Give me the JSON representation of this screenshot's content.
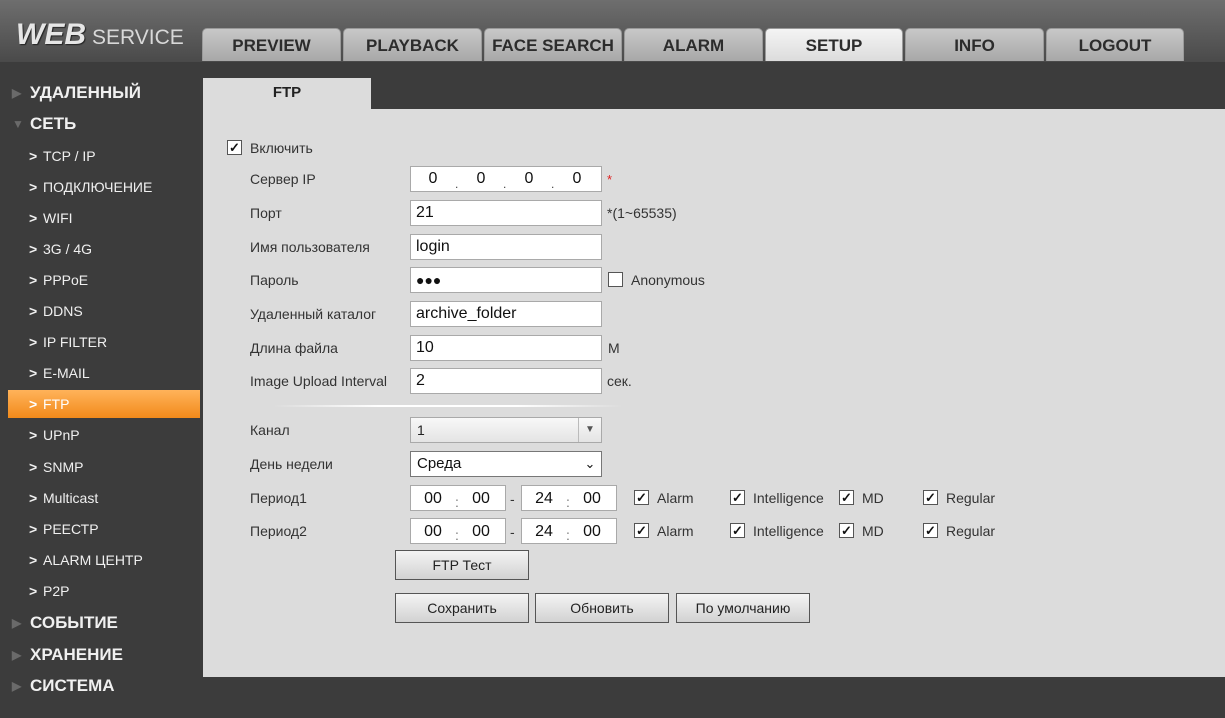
{
  "logo": {
    "word1": "WEB",
    "word2": "SERVICE"
  },
  "tabs": [
    {
      "label": "PREVIEW"
    },
    {
      "label": "PLAYBACK"
    },
    {
      "label": "FACE SEARCH"
    },
    {
      "label": "ALARM"
    },
    {
      "label": "SETUP"
    },
    {
      "label": "INFO"
    },
    {
      "label": "LOGOUT"
    }
  ],
  "active_tab": "SETUP",
  "sidebar": {
    "sections": [
      {
        "label": "УДАЛЕННЫЙ",
        "icon": "triangle-right-icon"
      },
      {
        "label": "СЕТЬ",
        "icon": "triangle-down-icon"
      },
      {
        "label": "СОБЫТИЕ",
        "icon": "triangle-right-icon"
      },
      {
        "label": "ХРАНЕНИЕ",
        "icon": "triangle-right-icon"
      },
      {
        "label": "СИСТЕМА",
        "icon": "triangle-right-icon"
      }
    ],
    "network_items": [
      {
        "label": "TCP / IP"
      },
      {
        "label": "ПОДКЛЮЧЕНИЕ"
      },
      {
        "label": "WIFI"
      },
      {
        "label": "3G / 4G"
      },
      {
        "label": "PPPoE"
      },
      {
        "label": "DDNS"
      },
      {
        "label": "IP FILTER"
      },
      {
        "label": "E-MAIL"
      },
      {
        "label": "FTP"
      },
      {
        "label": "UPnP"
      },
      {
        "label": "SNMP"
      },
      {
        "label": "Multicast"
      },
      {
        "label": "РЕЕСТР"
      },
      {
        "label": "ALARM ЦЕНТР"
      },
      {
        "label": "P2P"
      }
    ],
    "active_item": "FTP"
  },
  "subtab": {
    "label": "FTP"
  },
  "form": {
    "enable": {
      "label": "Включить",
      "checked": true,
      "mark": "✓"
    },
    "server_ip": {
      "label": "Сервер IP",
      "octets": [
        "0",
        "0",
        "0",
        "0"
      ],
      "required": "*"
    },
    "port": {
      "label": "Порт",
      "value": "21",
      "hint": "*(1~65535)"
    },
    "username": {
      "label": "Имя пользователя",
      "value": "login"
    },
    "password": {
      "label": "Пароль",
      "value": "●●●",
      "anonymous_label": "Anonymous",
      "anonymous_checked": false
    },
    "remote_dir": {
      "label": "Удаленный каталог",
      "value": "archive_folder"
    },
    "file_length": {
      "label": "Длина файла",
      "value": "10",
      "unit": "M"
    },
    "upload_interval": {
      "label": "Image Upload Interval",
      "value": "2",
      "unit": "сек."
    },
    "channel": {
      "label": "Канал",
      "value": "1"
    },
    "weekday": {
      "label": "День недели",
      "value": "Среда"
    },
    "periods": [
      {
        "label": "Период1",
        "start_h": "00",
        "start_m": "00",
        "end_h": "24",
        "end_m": "00"
      },
      {
        "label": "Период2",
        "start_h": "00",
        "start_m": "00",
        "end_h": "24",
        "end_m": "00"
      }
    ],
    "period_options": {
      "alarm": "Alarm",
      "intelligence": "Intelligence",
      "md": "MD",
      "regular": "Regular",
      "mark": "✓"
    },
    "buttons": {
      "ftp_test": "FTP Тест",
      "save": "Сохранить",
      "refresh": "Обновить",
      "default": "По умолчанию"
    }
  },
  "colors": {
    "accent": "#f28a1a",
    "sidebar_bg": "#3c3c3c",
    "panel_bg": "#dcdcdc",
    "required": "#e02020"
  }
}
